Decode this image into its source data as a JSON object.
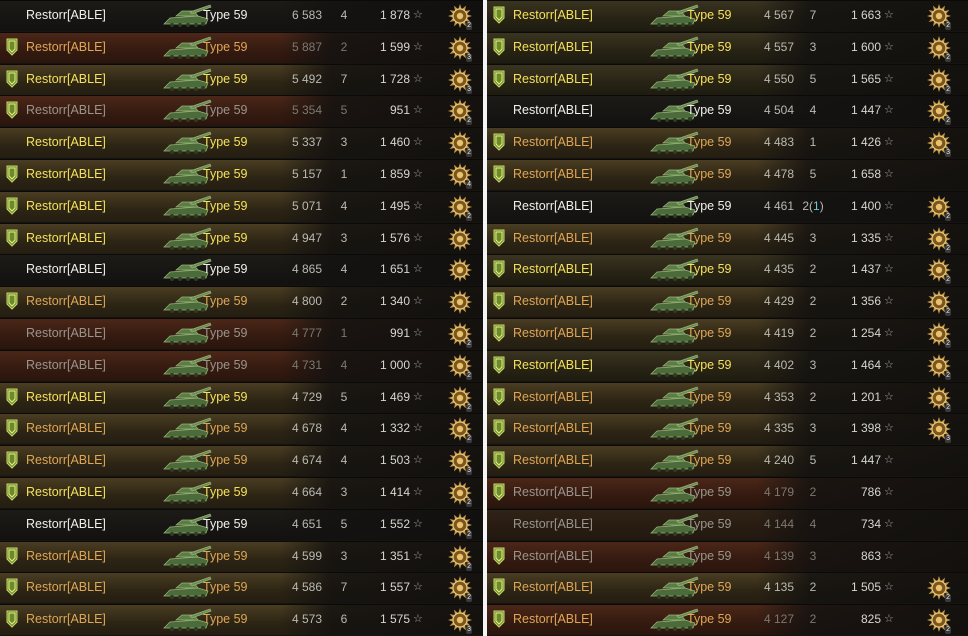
{
  "colors": {
    "name_white": "#f0f0ea",
    "name_yellow": "#f5e15a",
    "name_orange": "#e0a655",
    "name_grey": "#9a948c",
    "assist_blue": "#6fc6d8",
    "background": "#161411",
    "divider": "#f4f4f4"
  },
  "icons": {
    "flag": "shield-flag-icon",
    "tank": "type59-tank-icon",
    "star": "star-icon",
    "medal": "medal-icon"
  },
  "left_panel": {
    "rows": [
      {
        "player": "Restorr[ABLE]",
        "tank": "Type 59",
        "damage": "6 583",
        "kills": "4",
        "assist": "",
        "xp": "1 878",
        "name_color": "white",
        "bg": "plain",
        "flag": false,
        "medal": "2",
        "dim": false
      },
      {
        "player": "Restorr[ABLE]",
        "tank": "Type 59",
        "damage": "5 887",
        "kills": "2",
        "assist": "",
        "xp": "1 599",
        "name_color": "orange",
        "bg": "red",
        "flag": true,
        "medal": "3",
        "dim": true
      },
      {
        "player": "Restorr[ABLE]",
        "tank": "Type 59",
        "damage": "5 492",
        "kills": "7",
        "assist": "",
        "xp": "1 728",
        "name_color": "yellow",
        "bg": "gold",
        "flag": true,
        "medal": "3",
        "dim": false
      },
      {
        "player": "Restorr[ABLE]",
        "tank": "Type 59",
        "damage": "5 354",
        "kills": "5",
        "assist": "",
        "xp": "951",
        "name_color": "grey",
        "bg": "red",
        "flag": true,
        "medal": "2",
        "dim": true
      },
      {
        "player": "Restorr[ABLE]",
        "tank": "Type 59",
        "damage": "5 337",
        "kills": "3",
        "assist": "",
        "xp": "1 460",
        "name_color": "yellow",
        "bg": "gold",
        "flag": false,
        "medal": "2",
        "dim": false
      },
      {
        "player": "Restorr[ABLE]",
        "tank": "Type 59",
        "damage": "5 157",
        "kills": "1",
        "assist": "",
        "xp": "1 859",
        "name_color": "yellow",
        "bg": "gold",
        "flag": true,
        "medal": "4",
        "dim": false
      },
      {
        "player": "Restorr[ABLE]",
        "tank": "Type 59",
        "damage": "5 071",
        "kills": "4",
        "assist": "",
        "xp": "1 495",
        "name_color": "yellow",
        "bg": "gold",
        "flag": true,
        "medal": "2",
        "dim": false
      },
      {
        "player": "Restorr[ABLE]",
        "tank": "Type 59",
        "damage": "4 947",
        "kills": "3",
        "assist": "",
        "xp": "1 576",
        "name_color": "yellow",
        "bg": "gold",
        "flag": true,
        "medal": "",
        "dim": false
      },
      {
        "player": "Restorr[ABLE]",
        "tank": "Type 59",
        "damage": "4 865",
        "kills": "4",
        "assist": "",
        "xp": "1 651",
        "name_color": "white",
        "bg": "plain",
        "flag": false,
        "medal": "",
        "dim": false
      },
      {
        "player": "Restorr[ABLE]",
        "tank": "Type 59",
        "damage": "4 800",
        "kills": "2",
        "assist": "",
        "xp": "1 340",
        "name_color": "orange",
        "bg": "gold",
        "flag": true,
        "medal": "",
        "dim": false
      },
      {
        "player": "Restorr[ABLE]",
        "tank": "Type 59",
        "damage": "4 777",
        "kills": "1",
        "assist": "",
        "xp": "991",
        "name_color": "grey",
        "bg": "red",
        "flag": false,
        "medal": "2",
        "dim": true
      },
      {
        "player": "Restorr[ABLE]",
        "tank": "Type 59",
        "damage": "4 731",
        "kills": "4",
        "assist": "",
        "xp": "1 000",
        "name_color": "grey",
        "bg": "red",
        "flag": false,
        "medal": "2",
        "dim": true
      },
      {
        "player": "Restorr[ABLE]",
        "tank": "Type 59",
        "damage": "4 729",
        "kills": "5",
        "assist": "",
        "xp": "1 469",
        "name_color": "yellow",
        "bg": "gold",
        "flag": true,
        "medal": "2",
        "dim": false
      },
      {
        "player": "Restorr[ABLE]",
        "tank": "Type 59",
        "damage": "4 678",
        "kills": "4",
        "assist": "",
        "xp": "1 332",
        "name_color": "orange",
        "bg": "gold",
        "flag": true,
        "medal": "2",
        "dim": false
      },
      {
        "player": "Restorr[ABLE]",
        "tank": "Type 59",
        "damage": "4 674",
        "kills": "4",
        "assist": "",
        "xp": "1 503",
        "name_color": "orange",
        "bg": "gold",
        "flag": true,
        "medal": "3",
        "dim": false
      },
      {
        "player": "Restorr[ABLE]",
        "tank": "Type 59",
        "damage": "4 664",
        "kills": "3",
        "assist": "",
        "xp": "1 414",
        "name_color": "yellow",
        "bg": "gold",
        "flag": true,
        "medal": "2",
        "dim": false
      },
      {
        "player": "Restorr[ABLE]",
        "tank": "Type 59",
        "damage": "4 651",
        "kills": "5",
        "assist": "",
        "xp": "1 552",
        "name_color": "white",
        "bg": "plain",
        "flag": false,
        "medal": "2",
        "dim": false
      },
      {
        "player": "Restorr[ABLE]",
        "tank": "Type 59",
        "damage": "4 599",
        "kills": "3",
        "assist": "",
        "xp": "1 351",
        "name_color": "orange",
        "bg": "gold",
        "flag": true,
        "medal": "2",
        "dim": false
      },
      {
        "player": "Restorr[ABLE]",
        "tank": "Type 59",
        "damage": "4 586",
        "kills": "7",
        "assist": "",
        "xp": "1 557",
        "name_color": "orange",
        "bg": "gold",
        "flag": true,
        "medal": "2",
        "dim": false
      },
      {
        "player": "Restorr[ABLE]",
        "tank": "Type 59",
        "damage": "4 573",
        "kills": "6",
        "assist": "",
        "xp": "1 575",
        "name_color": "orange",
        "bg": "gold",
        "flag": true,
        "medal": "3",
        "dim": false
      }
    ]
  },
  "right_panel": {
    "rows": [
      {
        "player": "Restorr[ABLE]",
        "tank": "Type 59",
        "damage": "4 567",
        "kills": "7",
        "assist": "",
        "xp": "1 663",
        "name_color": "yellow",
        "bg": "olive",
        "flag": true,
        "medal": "2",
        "dim": false
      },
      {
        "player": "Restorr[ABLE]",
        "tank": "Type 59",
        "damage": "4 557",
        "kills": "3",
        "assist": "",
        "xp": "1 600",
        "name_color": "yellow",
        "bg": "olive",
        "flag": true,
        "medal": "2",
        "dim": false
      },
      {
        "player": "Restorr[ABLE]",
        "tank": "Type 59",
        "damage": "4 550",
        "kills": "5",
        "assist": "",
        "xp": "1 565",
        "name_color": "yellow",
        "bg": "olive",
        "flag": true,
        "medal": "2",
        "dim": false
      },
      {
        "player": "Restorr[ABLE]",
        "tank": "Type 59",
        "damage": "4 504",
        "kills": "4",
        "assist": "",
        "xp": "1 447",
        "name_color": "white",
        "bg": "plain",
        "flag": false,
        "medal": "2",
        "dim": false
      },
      {
        "player": "Restorr[ABLE]",
        "tank": "Type 59",
        "damage": "4 483",
        "kills": "1",
        "assist": "",
        "xp": "1 426",
        "name_color": "orange",
        "bg": "gold",
        "flag": true,
        "medal": "3",
        "dim": false
      },
      {
        "player": "Restorr[ABLE]",
        "tank": "Type 59",
        "damage": "4 478",
        "kills": "5",
        "assist": "",
        "xp": "1 658",
        "name_color": "orange",
        "bg": "gold",
        "flag": true,
        "medal": "",
        "dim": false
      },
      {
        "player": "Restorr[ABLE]",
        "tank": "Type 59",
        "damage": "4 461",
        "kills": "2",
        "assist": "1",
        "xp": "1 400",
        "name_color": "white",
        "bg": "plain",
        "flag": false,
        "medal": "2",
        "dim": false
      },
      {
        "player": "Restorr[ABLE]",
        "tank": "Type 59",
        "damage": "4 445",
        "kills": "3",
        "assist": "",
        "xp": "1 335",
        "name_color": "orange",
        "bg": "gold",
        "flag": true,
        "medal": "2",
        "dim": false
      },
      {
        "player": "Restorr[ABLE]",
        "tank": "Type 59",
        "damage": "4 435",
        "kills": "2",
        "assist": "",
        "xp": "1 437",
        "name_color": "yellow",
        "bg": "olive",
        "flag": true,
        "medal": "2",
        "dim": false
      },
      {
        "player": "Restorr[ABLE]",
        "tank": "Type 59",
        "damage": "4 429",
        "kills": "2",
        "assist": "",
        "xp": "1 356",
        "name_color": "orange",
        "bg": "gold",
        "flag": true,
        "medal": "2",
        "dim": false
      },
      {
        "player": "Restorr[ABLE]",
        "tank": "Type 59",
        "damage": "4 419",
        "kills": "2",
        "assist": "",
        "xp": "1 254",
        "name_color": "orange",
        "bg": "gold",
        "flag": true,
        "medal": "2",
        "dim": false
      },
      {
        "player": "Restorr[ABLE]",
        "tank": "Type 59",
        "damage": "4 402",
        "kills": "3",
        "assist": "",
        "xp": "1 464",
        "name_color": "yellow",
        "bg": "olive",
        "flag": true,
        "medal": "2",
        "dim": false
      },
      {
        "player": "Restorr[ABLE]",
        "tank": "Type 59",
        "damage": "4 353",
        "kills": "2",
        "assist": "",
        "xp": "1 201",
        "name_color": "orange",
        "bg": "gold",
        "flag": true,
        "medal": "2",
        "dim": false
      },
      {
        "player": "Restorr[ABLE]",
        "tank": "Type 59",
        "damage": "4 335",
        "kills": "3",
        "assist": "",
        "xp": "1 398",
        "name_color": "orange",
        "bg": "gold",
        "flag": true,
        "medal": "3",
        "dim": false
      },
      {
        "player": "Restorr[ABLE]",
        "tank": "Type 59",
        "damage": "4 240",
        "kills": "5",
        "assist": "",
        "xp": "1 447",
        "name_color": "orange",
        "bg": "gold",
        "flag": true,
        "medal": "",
        "dim": false
      },
      {
        "player": "Restorr[ABLE]",
        "tank": "Type 59",
        "damage": "4 179",
        "kills": "2",
        "assist": "",
        "xp": "786",
        "name_color": "grey",
        "bg": "red",
        "flag": true,
        "medal": "",
        "dim": true
      },
      {
        "player": "Restorr[ABLE]",
        "tank": "Type 59",
        "damage": "4 144",
        "kills": "4",
        "assist": "",
        "xp": "734",
        "name_color": "grey",
        "bg": "dim",
        "flag": false,
        "medal": "",
        "dim": true
      },
      {
        "player": "Restorr[ABLE]",
        "tank": "Type 59",
        "damage": "4 139",
        "kills": "3",
        "assist": "",
        "xp": "863",
        "name_color": "grey",
        "bg": "red",
        "flag": true,
        "medal": "",
        "dim": true
      },
      {
        "player": "Restorr[ABLE]",
        "tank": "Type 59",
        "damage": "4 135",
        "kills": "2",
        "assist": "",
        "xp": "1 505",
        "name_color": "orange",
        "bg": "gold",
        "flag": true,
        "medal": "2",
        "dim": false
      },
      {
        "player": "Restorr[ABLE]",
        "tank": "Type 59",
        "damage": "4 127",
        "kills": "2",
        "assist": "",
        "xp": "825",
        "name_color": "orange",
        "bg": "red",
        "flag": true,
        "medal": "2",
        "dim": true
      }
    ]
  }
}
